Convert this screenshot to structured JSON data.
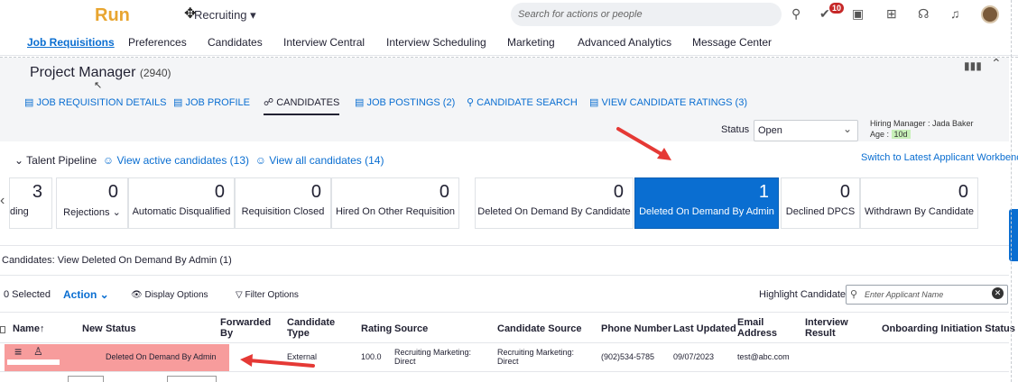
{
  "header": {
    "logo": "Run",
    "module": "Recruiting ▾",
    "search_placeholder": "Search for actions or people",
    "notification_count": "10"
  },
  "nav": [
    "Job Requisitions",
    "Preferences",
    "Candidates",
    "Interview Central",
    "Interview Scheduling",
    "Marketing",
    "Advanced Analytics",
    "Message Center"
  ],
  "requisition": {
    "title": "Project Manager",
    "id": "(2940)",
    "tabs": [
      "JOB REQUISITION DETAILS",
      "JOB PROFILE",
      "CANDIDATES",
      "JOB POSTINGS (2)",
      "CANDIDATE SEARCH",
      "VIEW CANDIDATE RATINGS (3)"
    ],
    "status_label": "Status",
    "status_value": "Open",
    "hiring_manager": "Hiring Manager : Jada Baker",
    "age_label": "Age :",
    "age_value": "10d"
  },
  "pipeline": {
    "title": "Talent Pipeline",
    "active_link": "View active candidates (13)",
    "all_link": "View all candidates (14)",
    "switch_link": "Switch to Latest Applicant Workbench",
    "tiles": [
      {
        "count": "3",
        "label": "ding"
      },
      {
        "count": "0",
        "label": "Rejections ⌄"
      },
      {
        "count": "0",
        "label": "Automatic Disqualified"
      },
      {
        "count": "0",
        "label": "Requisition Closed"
      },
      {
        "count": "0",
        "label": "Hired On Other Requisition"
      },
      {
        "count": "0",
        "label": "Deleted On Demand By Candidate"
      },
      {
        "count": "1",
        "label": "Deleted On Demand By Admin"
      },
      {
        "count": "0",
        "label": "Declined DPCS"
      },
      {
        "count": "0",
        "label": "Withdrawn By Candidate"
      }
    ]
  },
  "list": {
    "section_label": "Candidates: View Deleted On Demand By Admin (1)",
    "selected": "0 Selected",
    "action": "Action ⌄",
    "display_options": "Display Options",
    "filter_options": "Filter Options",
    "highlight_label": "Highlight Candidate",
    "highlight_placeholder": "Enter Applicant Name",
    "columns": [
      "Name",
      "New",
      "Status",
      "Forwarded By",
      "Candidate Type",
      "Rating",
      "Source",
      "Candidate Source",
      "Phone Number",
      "Last Updated",
      "Email Address",
      "Interview Result",
      "Onboarding Initiation Status"
    ],
    "row": {
      "status": "Deleted On Demand By Admin",
      "type": "External",
      "rating": "100.0",
      "source": "Recruiting Marketing: Direct",
      "candidate_source": "Recruiting Marketing: Direct",
      "phone": "(902)534-5785",
      "updated": "09/07/2023",
      "email": "test@abc.com"
    }
  }
}
